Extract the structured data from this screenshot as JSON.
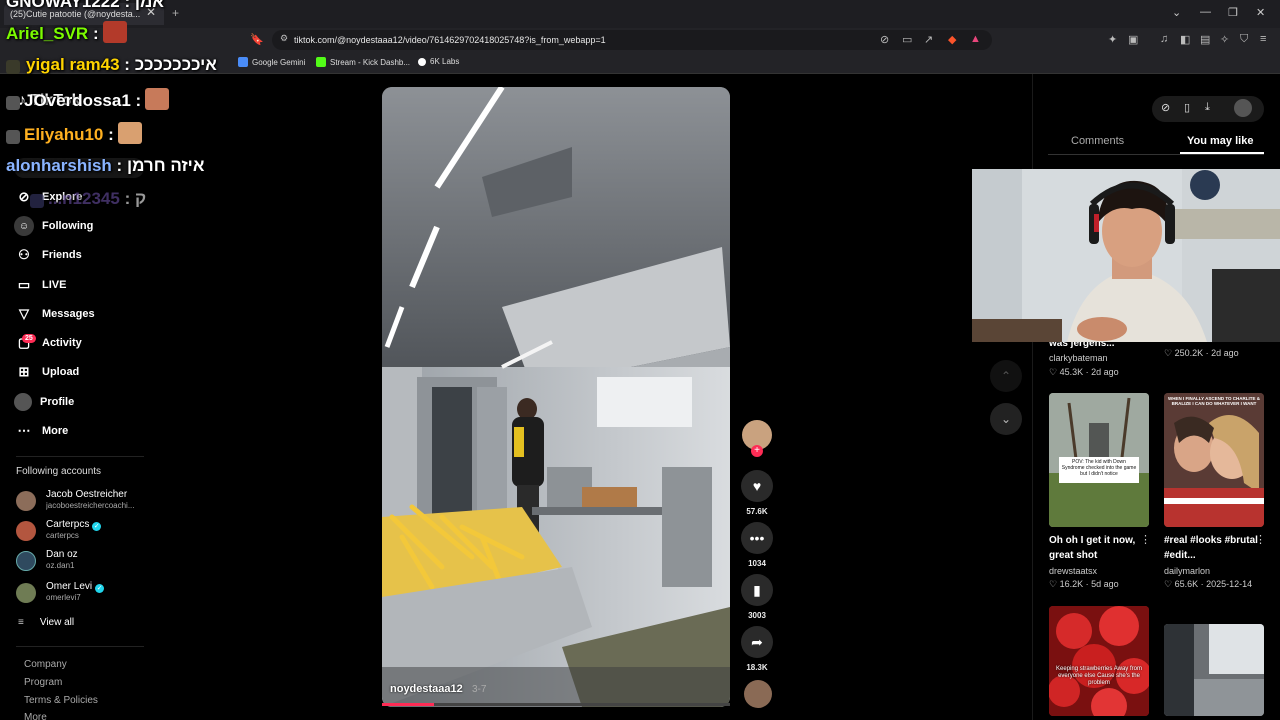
{
  "browser": {
    "tab_title": "(25)Cutie patootie (@noydesta...",
    "url": "tiktok.com/@noydestaaa12/video/7614629702418025748?is_from_webapp=1",
    "new_tab": "+",
    "close": "✕",
    "bookmarks": [
      {
        "label": "Google Gemini",
        "color": "#4a8cf7"
      },
      {
        "label": "Stream - Kick Dashb...",
        "color": "#53fc18"
      },
      {
        "label": "6K Labs",
        "color": "#ffffff"
      }
    ]
  },
  "chat": [
    {
      "user": "GNOWAY1222",
      "text": ": אמן",
      "user_color": "#ffffff"
    },
    {
      "user": "Ariel_SVR",
      "text": ":",
      "user_color": "#7cfc00"
    },
    {
      "user": "yigal ram43",
      "text": ": איכככככככ",
      "user_color": "#ffd400"
    },
    {
      "user": "JOverdossa1",
      "text": ":",
      "user_color": "#ffffff"
    },
    {
      "user": "Eliyahu10",
      "text": ":",
      "user_color": "#ffb020"
    },
    {
      "user": "alonharshish",
      "text": ": איזה חרמן",
      "user_color": "#8ab4ff"
    },
    {
      "user": "...n12345",
      "text": ": ק",
      "user_color": "#6a4fa3"
    }
  ],
  "nav": {
    "items": [
      {
        "label": "Explore",
        "icon": "compass-icon"
      },
      {
        "label": "Following",
        "icon": "following-icon"
      },
      {
        "label": "Friends",
        "icon": "friends-icon"
      },
      {
        "label": "LIVE",
        "icon": "live-icon"
      },
      {
        "label": "Messages",
        "icon": "messages-icon"
      },
      {
        "label": "Activity",
        "icon": "activity-icon"
      },
      {
        "label": "Upload",
        "icon": "upload-icon"
      },
      {
        "label": "Profile",
        "icon": "profile-icon"
      },
      {
        "label": "More",
        "icon": "more-icon"
      }
    ],
    "activity_badge": "25"
  },
  "following_accounts": {
    "title": "Following accounts",
    "accounts": [
      {
        "name": "Jacob Oestreicher",
        "handle": "jacoboestreichercoachi...",
        "verified": false
      },
      {
        "name": "Carterpcs",
        "handle": "carterpcs",
        "verified": true
      },
      {
        "name": "Dan oz",
        "handle": "oz.dan1",
        "verified": false
      },
      {
        "name": "Omer Levi",
        "handle": "omerlevi7",
        "verified": true
      }
    ],
    "view_all": "View all"
  },
  "footer": [
    "Company",
    "Program",
    "Terms & Policies",
    "More"
  ],
  "video": {
    "author": "noydestaaa12",
    "date": "3-7",
    "progress": 0.15
  },
  "actions": {
    "likes": "57.6K",
    "comments": "1034",
    "saves": "3003",
    "shares": "18.3K"
  },
  "panel": {
    "tabs": [
      "Comments",
      "You may like"
    ],
    "active_tab": "You may like"
  },
  "recommendations": [
    {
      "title": "was jergens...",
      "user": "clarkybateman",
      "likes": "45.3K",
      "age": "2d ago",
      "img": "none"
    },
    {
      "title": "",
      "user": "",
      "likes": "250.2K",
      "age": "2d ago",
      "img": "none"
    },
    {
      "title": "Oh oh I get it now, great shot",
      "user": "drewstaatsx",
      "likes": "16.2K",
      "age": "5d ago",
      "img": "trampoline",
      "overlay": "POV: The kid with Down Syndrome checked into the game but I didn't notice"
    },
    {
      "title": "#real #looks #brutal #edit...",
      "user": "dailymarlon",
      "likes": "65.6K",
      "age": "2025-12-14",
      "img": "couple",
      "overlay": "WHEN I FINALLY ASCEND TO CHARLITE & BRALIZE I CAN DO WHATEVER I WANT"
    },
    {
      "title": "",
      "user": "",
      "likes": "",
      "age": "",
      "img": "strawberries",
      "overlay": "Keeping strawberries Away from everyone else Cause she's the problem"
    },
    {
      "title": "",
      "user": "",
      "likes": "",
      "age": "",
      "img": "snow"
    }
  ]
}
